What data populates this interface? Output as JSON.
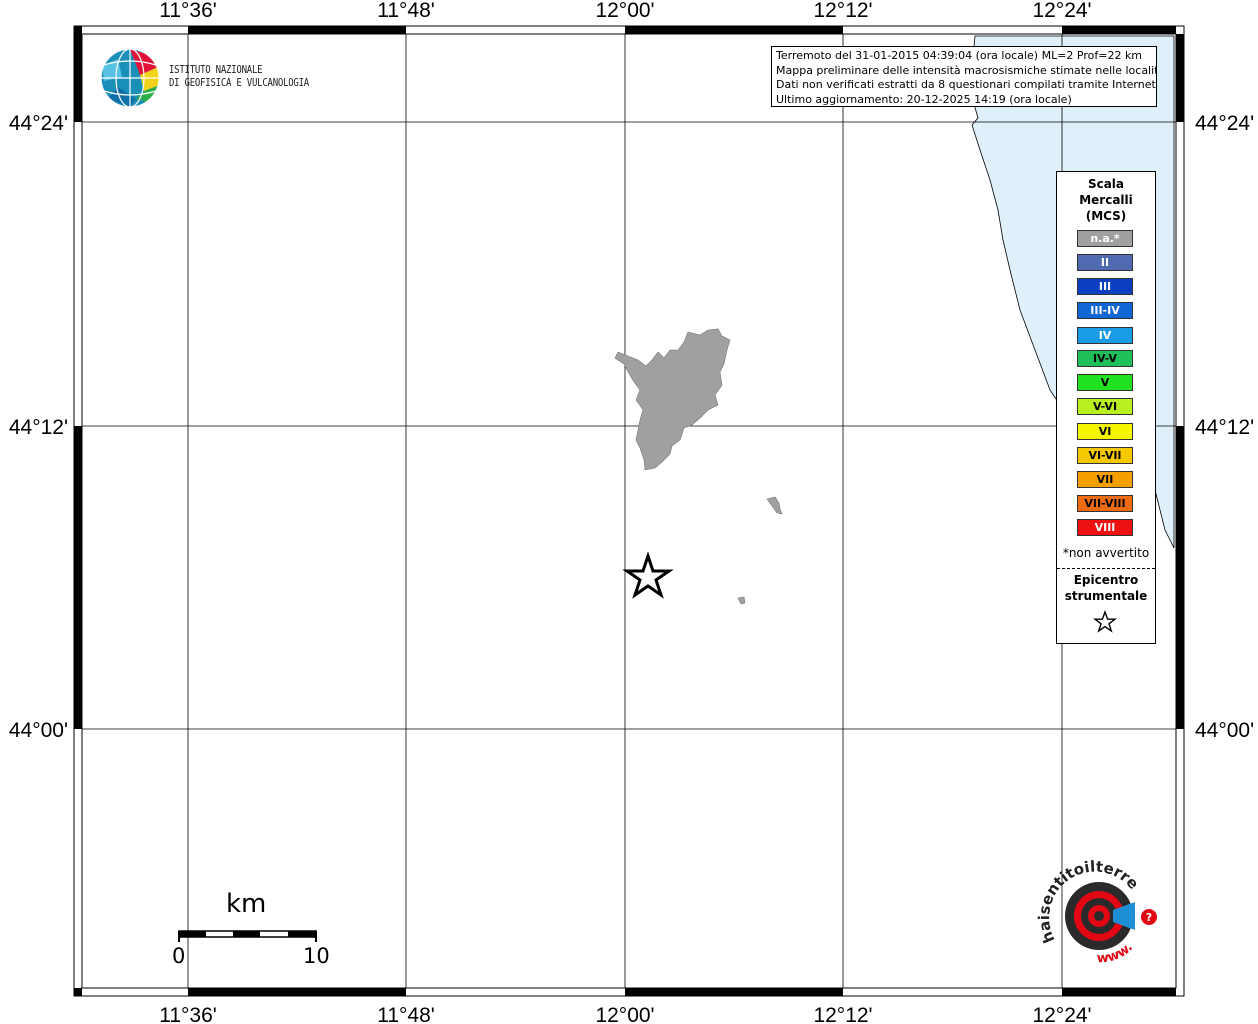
{
  "info": {
    "line1": "Terremoto del 31-01-2015 04:39:04 (ora locale) ML=2 Prof=22 km",
    "line2": "Mappa preliminare delle intensità macrosismiche stimate nelle località",
    "line3": "Dati non verificati estratti da 8 questionari compilati tramite Internet.",
    "line4": "Ultimo aggiornamento: 20-12-2025 14:19 (ora locale)"
  },
  "ingv": {
    "line1": "ISTITUTO NAZIONALE",
    "line2": "DI GEOFISICA E VULCANOLOGIA"
  },
  "axes": {
    "lon_labels": [
      "11°36'",
      "11°48'",
      "12°00'",
      "12°12'",
      "12°24'"
    ],
    "lat_labels": [
      "44°24'",
      "44°12'",
      "44°00'"
    ]
  },
  "legend": {
    "title_line1": "Scala",
    "title_line2": "Mercalli",
    "title_line3": "(MCS)",
    "items": [
      {
        "label": "n.a.*",
        "color": "#a0a0a0"
      },
      {
        "label": "II",
        "color": "#4f6ab0"
      },
      {
        "label": "III",
        "color": "#0a3fc2"
      },
      {
        "label": "III-IV",
        "color": "#1166d6"
      },
      {
        "label": "IV",
        "color": "#1a9be6"
      },
      {
        "label": "IV-V",
        "color": "#1fbf5a"
      },
      {
        "label": "V",
        "color": "#22e022"
      },
      {
        "label": "V-VI",
        "color": "#b8f020"
      },
      {
        "label": "VI",
        "color": "#f5f500"
      },
      {
        "label": "VI-VII",
        "color": "#f5c800"
      },
      {
        "label": "VII",
        "color": "#f5a000"
      },
      {
        "label": "VII-VIII",
        "color": "#f06a10"
      },
      {
        "label": "VIII",
        "color": "#ee1111"
      }
    ],
    "note": "*non avvertito",
    "epicenter_line1": "Epicentro",
    "epicenter_line2": "strumentale"
  },
  "scale_bar": {
    "unit": "km",
    "start": "0",
    "end": "10"
  },
  "logo": {
    "ring_text": "haisentitoilterremoto.it",
    "www_text": "www."
  },
  "colors": {
    "sea": "#e0f0fa",
    "municipality": "#a0a0a0",
    "grid": "#000000"
  }
}
